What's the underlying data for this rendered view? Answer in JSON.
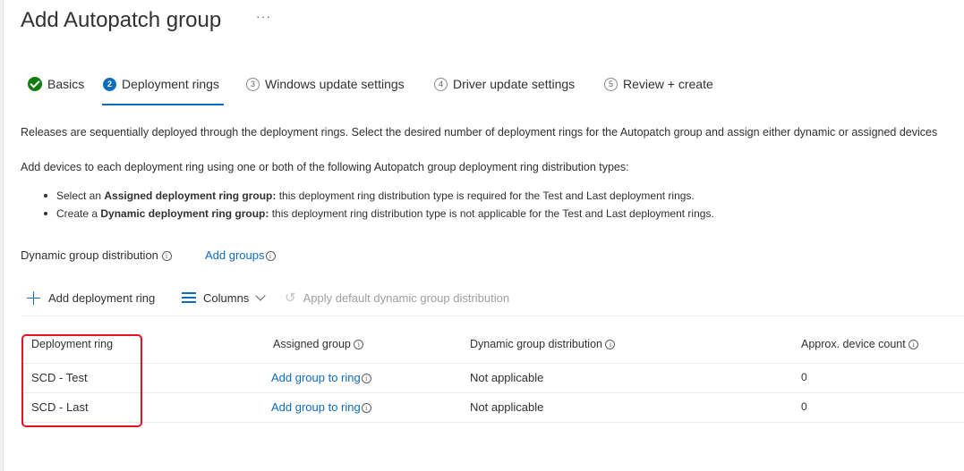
{
  "page": {
    "title": "Add Autopatch group",
    "more_label": "···"
  },
  "tabs": [
    {
      "label": "Basics",
      "state": "completed"
    },
    {
      "number": "2",
      "label": "Deployment rings",
      "state": "active"
    },
    {
      "number": "3",
      "label": "Windows update settings",
      "state": "pending"
    },
    {
      "number": "4",
      "label": "Driver update settings",
      "state": "pending"
    },
    {
      "number": "5",
      "label": "Review + create",
      "state": "pending"
    }
  ],
  "content": {
    "description": "Releases are sequentially deployed through the deployment rings. Select the desired number of deployment rings for the Autopatch group and assign either dynamic or assigned devices",
    "distribution_intro": "Add devices to each deployment ring using one or both of the following Autopatch group deployment ring distribution types:",
    "bullets": [
      {
        "prefix": "Select an ",
        "bold": "Assigned deployment ring group:",
        "text": " this deployment ring distribution type is required for the Test and Last deployment rings."
      },
      {
        "prefix": "Create a ",
        "bold": "Dynamic deployment ring group:",
        "text": " this deployment ring distribution type is not applicable for the Test and Last deployment rings."
      }
    ],
    "dynamic_group_distribution_label": "Dynamic group distribution",
    "add_groups_label": "Add groups"
  },
  "toolbar": {
    "add_ring_label": "Add deployment ring",
    "columns_label": "Columns",
    "apply_default_label": "Apply default dynamic group distribution"
  },
  "table": {
    "columns": [
      "Deployment ring",
      "Assigned group",
      "Dynamic group distribution",
      "Approx. device count"
    ],
    "rows": [
      {
        "ring": "SCD - Test",
        "assigned": "Add group to ring",
        "dynamic": "Not applicable",
        "count": "0"
      },
      {
        "ring": "SCD - Last",
        "assigned": "Add group to ring",
        "dynamic": "Not applicable",
        "count": "0"
      }
    ]
  },
  "colors": {
    "accent": "#0f6cbd",
    "completed": "#107c10",
    "highlight_border": "#e81123"
  },
  "icons": {
    "more": "more-icon",
    "completed_step": "check-circle-icon",
    "info": "info-icon",
    "add": "plus-icon",
    "columns": "columns-icon",
    "dropdown": "chevron-down-icon",
    "apply_default": "undo-icon"
  }
}
